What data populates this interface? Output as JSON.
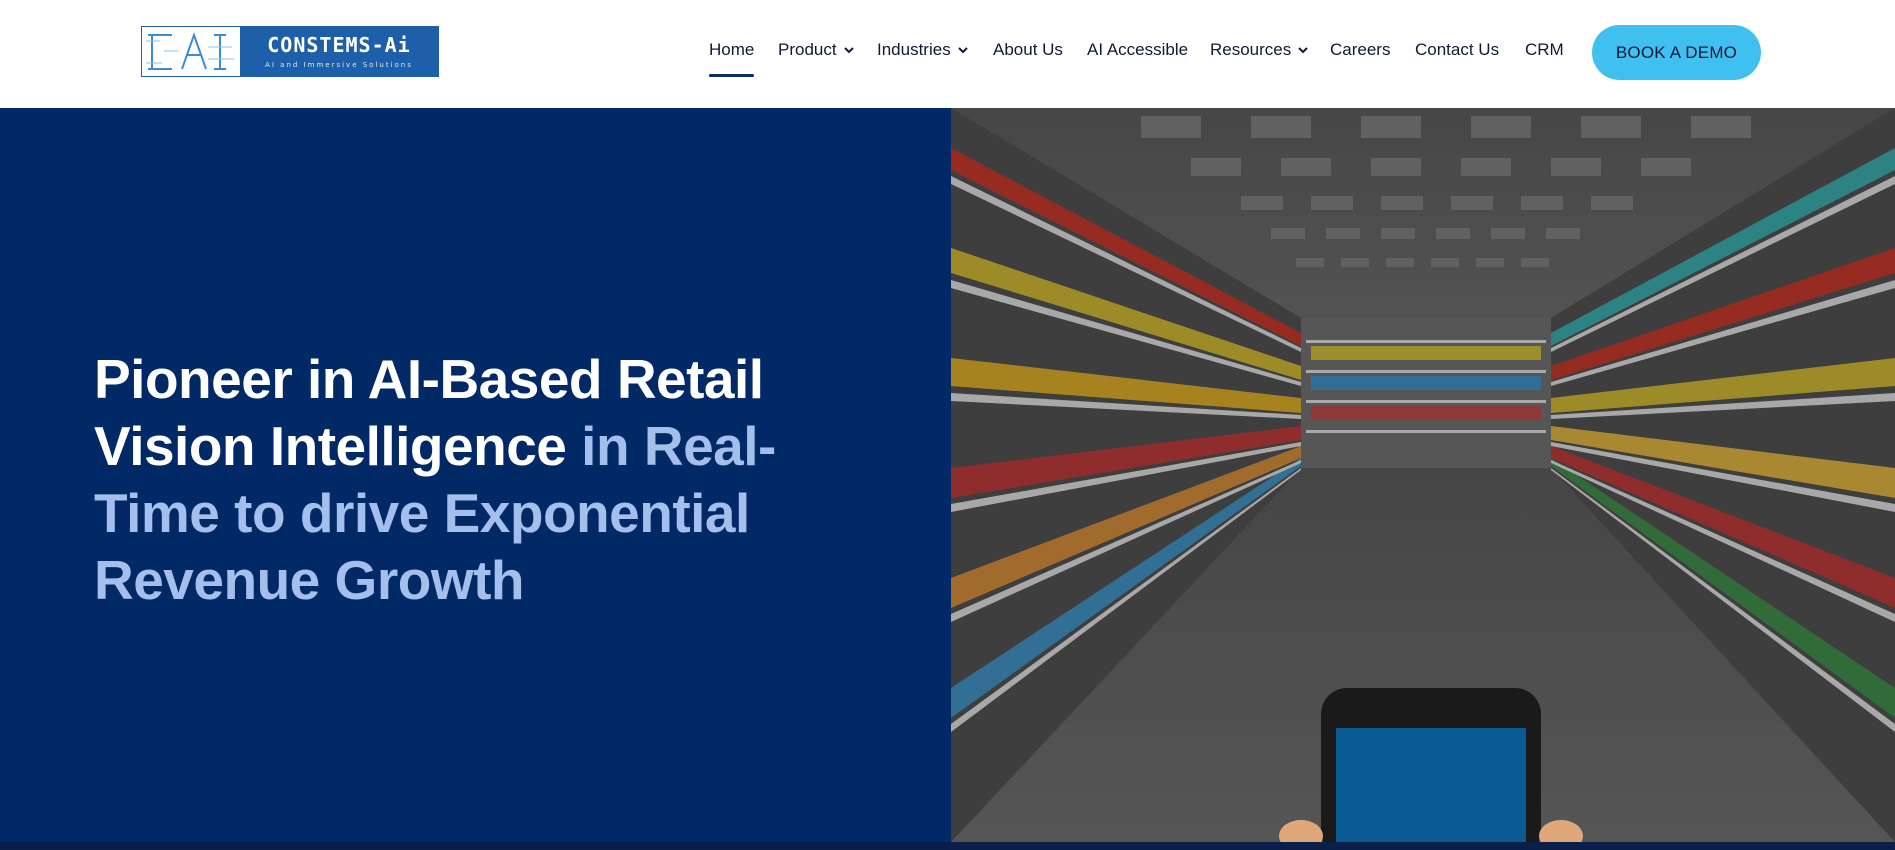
{
  "logo": {
    "mark_text": "CAI",
    "brand": "CONSTEMS-Ai",
    "tagline": "AI and Immersive Solutions"
  },
  "nav": {
    "items": [
      {
        "label": "Home",
        "active": true,
        "dropdown": false
      },
      {
        "label": "Product",
        "active": false,
        "dropdown": true
      },
      {
        "label": "Industries",
        "active": false,
        "dropdown": true
      },
      {
        "label": "About Us",
        "active": false,
        "dropdown": false
      },
      {
        "label": "AI Accessible",
        "active": false,
        "dropdown": false
      },
      {
        "label": "Resources",
        "active": false,
        "dropdown": true
      },
      {
        "label": "Careers",
        "active": false,
        "dropdown": false
      },
      {
        "label": "Contact Us",
        "active": false,
        "dropdown": false
      },
      {
        "label": "CRM",
        "active": false,
        "dropdown": false
      }
    ],
    "cta_label": "BOOK A DEMO"
  },
  "hero": {
    "title_strong": "Pioneer in AI-Based Retail Vision Intelligence",
    "title_light": " in Real-Time to drive Exponential Revenue Growth",
    "image_alt": "supermarket-aisle-with-smartphone"
  },
  "colors": {
    "hero_bg": "#002966",
    "cta_bg": "#40c0ef",
    "logo_blue": "#1d5fa8",
    "active_underline": "#0d2b6b"
  }
}
